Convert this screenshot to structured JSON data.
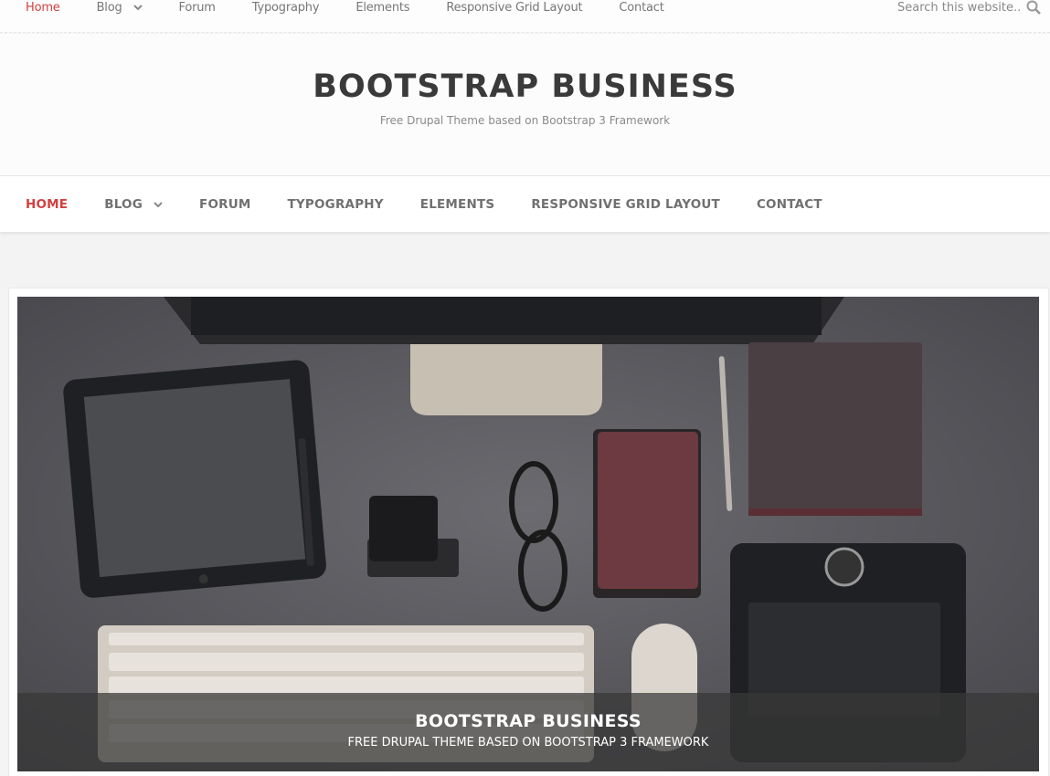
{
  "top_nav": {
    "items": [
      {
        "label": "Home",
        "active": true
      },
      {
        "label": "Blog",
        "has_dropdown": true
      },
      {
        "label": "Forum"
      },
      {
        "label": "Typography"
      },
      {
        "label": "Elements"
      },
      {
        "label": "Responsive Grid Layout"
      },
      {
        "label": "Contact"
      }
    ],
    "search_placeholder": "Search this website...",
    "search_icon": "magnifier-icon"
  },
  "branding": {
    "site_name": "BOOTSTRAP BUSINESS",
    "slogan": "Free Drupal Theme based on Bootstrap 3 Framework"
  },
  "main_nav": {
    "items": [
      {
        "label": "HOME",
        "active": true
      },
      {
        "label": "BLOG",
        "has_dropdown": true
      },
      {
        "label": "FORUM"
      },
      {
        "label": "TYPOGRAPHY"
      },
      {
        "label": "ELEMENTS"
      },
      {
        "label": "RESPONSIVE GRID LAYOUT"
      },
      {
        "label": "CONTACT"
      }
    ]
  },
  "slideshow": {
    "caption_title": "BOOTSTRAP BUSINESS",
    "caption_subtitle": "FREE DRUPAL THEME BASED ON BOOTSTRAP 3 FRAMEWORK"
  },
  "colors": {
    "accent": "#d33f3f",
    "nav_text": "#707070",
    "site_name": "#3a3a3a"
  }
}
